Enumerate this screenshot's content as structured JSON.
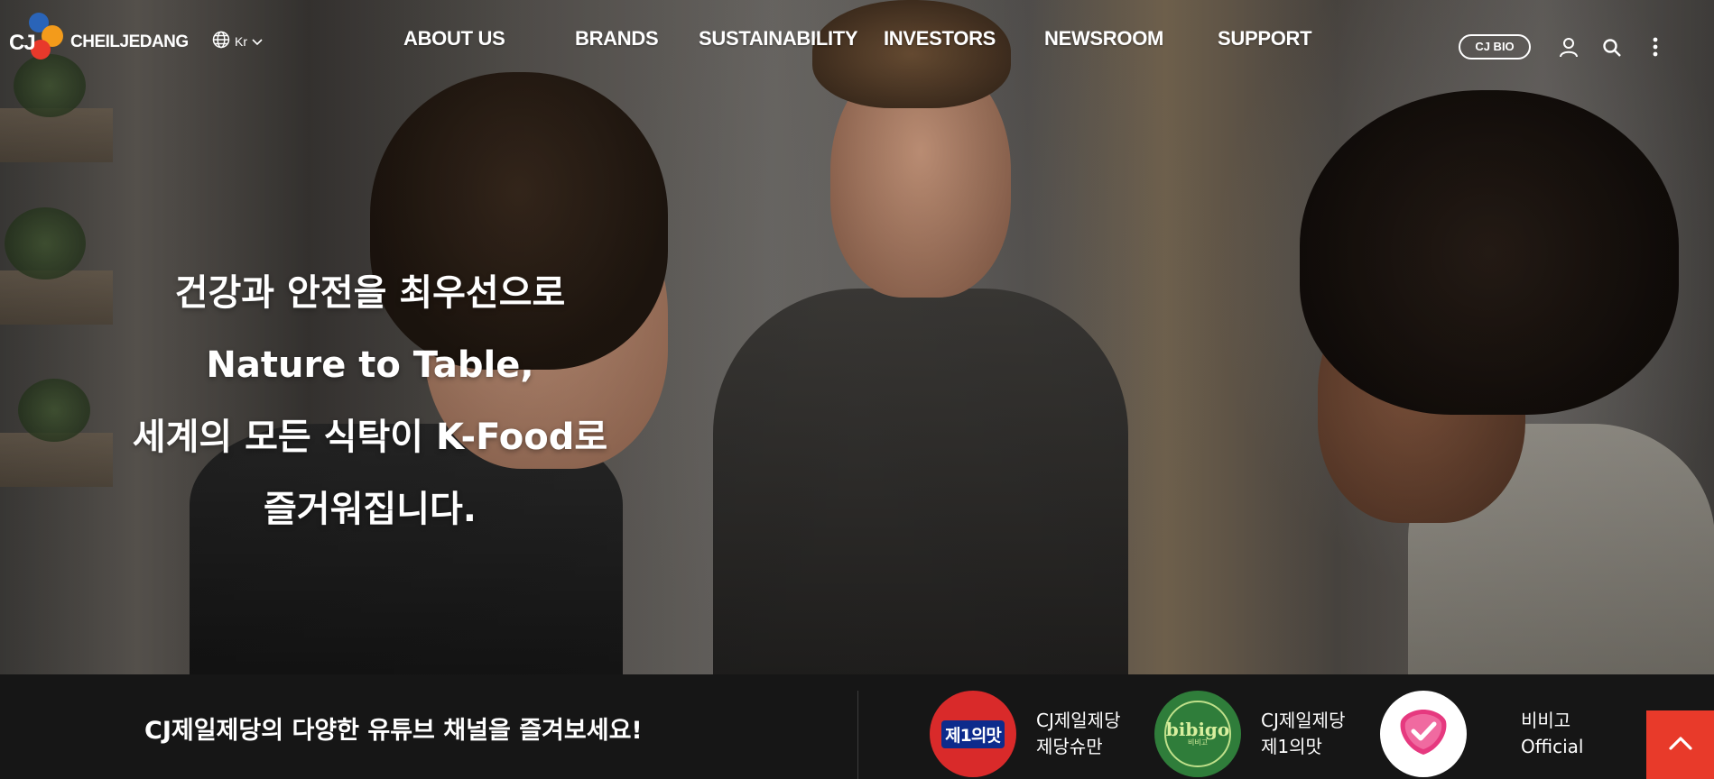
{
  "header": {
    "logo": {
      "cj": "CJ",
      "name": "CHEILJEDANG",
      "colors": {
        "red": "#e8392b",
        "orange": "#f39b1b",
        "blue": "#2a64b8"
      }
    },
    "language": {
      "label": "Kr",
      "icon": "globe-icon"
    },
    "nav": [
      {
        "label": "ABOUT US"
      },
      {
        "label": "BRANDS"
      },
      {
        "label": "SUSTAINABILITY"
      },
      {
        "label": "INVESTORS"
      },
      {
        "label": "NEWSROOM"
      },
      {
        "label": "SUPPORT"
      }
    ],
    "cjbio_label": "CJ BIO",
    "icons": [
      "user-icon",
      "search-icon",
      "more-vertical-icon"
    ]
  },
  "hero": {
    "lines": [
      "건강과 안전을 최우선으로",
      "Nature to Table,",
      "세계의 모든 식탁이 K-Food로",
      "즐거워집니다."
    ]
  },
  "youtube": {
    "title": "CJ제일제당의 다양한 유튜브 채널을 즐겨보세요!",
    "channels": [
      {
        "logo_text": "제1의맛",
        "line1": "CJ제일제당",
        "line2": "제당슈만",
        "color": "#d92a2a"
      },
      {
        "logo_text": "bibigo",
        "logo_sub": "비비고",
        "line1": "CJ제일제당",
        "line2": "제1의맛",
        "color": "#2f7d3a"
      },
      {
        "logo_text": "",
        "line1": "비비고",
        "line2": "Official",
        "color": "#ffffff",
        "accent": "#e6397f"
      }
    ]
  },
  "to_top": {
    "icon": "chevron-up-icon",
    "color": "#e83a2a"
  }
}
